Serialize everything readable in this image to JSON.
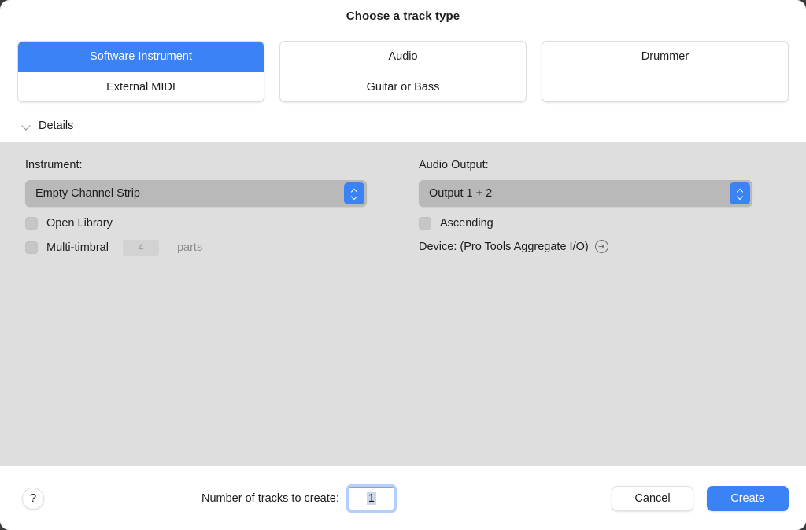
{
  "dialog": {
    "title": "Choose a track type"
  },
  "track_types": {
    "groups": [
      {
        "name": "midi-group",
        "options": [
          {
            "label": "Software Instrument",
            "selected": true
          },
          {
            "label": "External MIDI",
            "selected": false
          }
        ]
      },
      {
        "name": "audio-group",
        "options": [
          {
            "label": "Audio",
            "selected": false
          },
          {
            "label": "Guitar or Bass",
            "selected": false
          }
        ]
      },
      {
        "name": "drummer-group",
        "options": [
          {
            "label": "Drummer",
            "selected": false
          }
        ]
      }
    ]
  },
  "details": {
    "disclosure_label": "Details",
    "expanded": true,
    "instrument": {
      "label": "Instrument:",
      "value": "Empty Channel Strip",
      "open_library": {
        "label": "Open Library",
        "checked": false
      },
      "multi_timbral": {
        "label": "Multi-timbral",
        "checked": false
      },
      "parts_value": "4",
      "parts_label": "parts"
    },
    "audio_output": {
      "label": "Audio Output:",
      "value": "Output 1 + 2",
      "ascending": {
        "label": "Ascending",
        "checked": false
      },
      "device_text": "Device: (Pro Tools Aggregate I/O)"
    }
  },
  "footer": {
    "help_label": "?",
    "tracks_label": "Number of tracks to create:",
    "tracks_value": "1",
    "cancel_label": "Cancel",
    "create_label": "Create"
  },
  "colors": {
    "accent": "#3b82f6",
    "panel_bg": "#dedede",
    "popup_bg": "#b9b9b9",
    "text": "#1d1d1f"
  }
}
